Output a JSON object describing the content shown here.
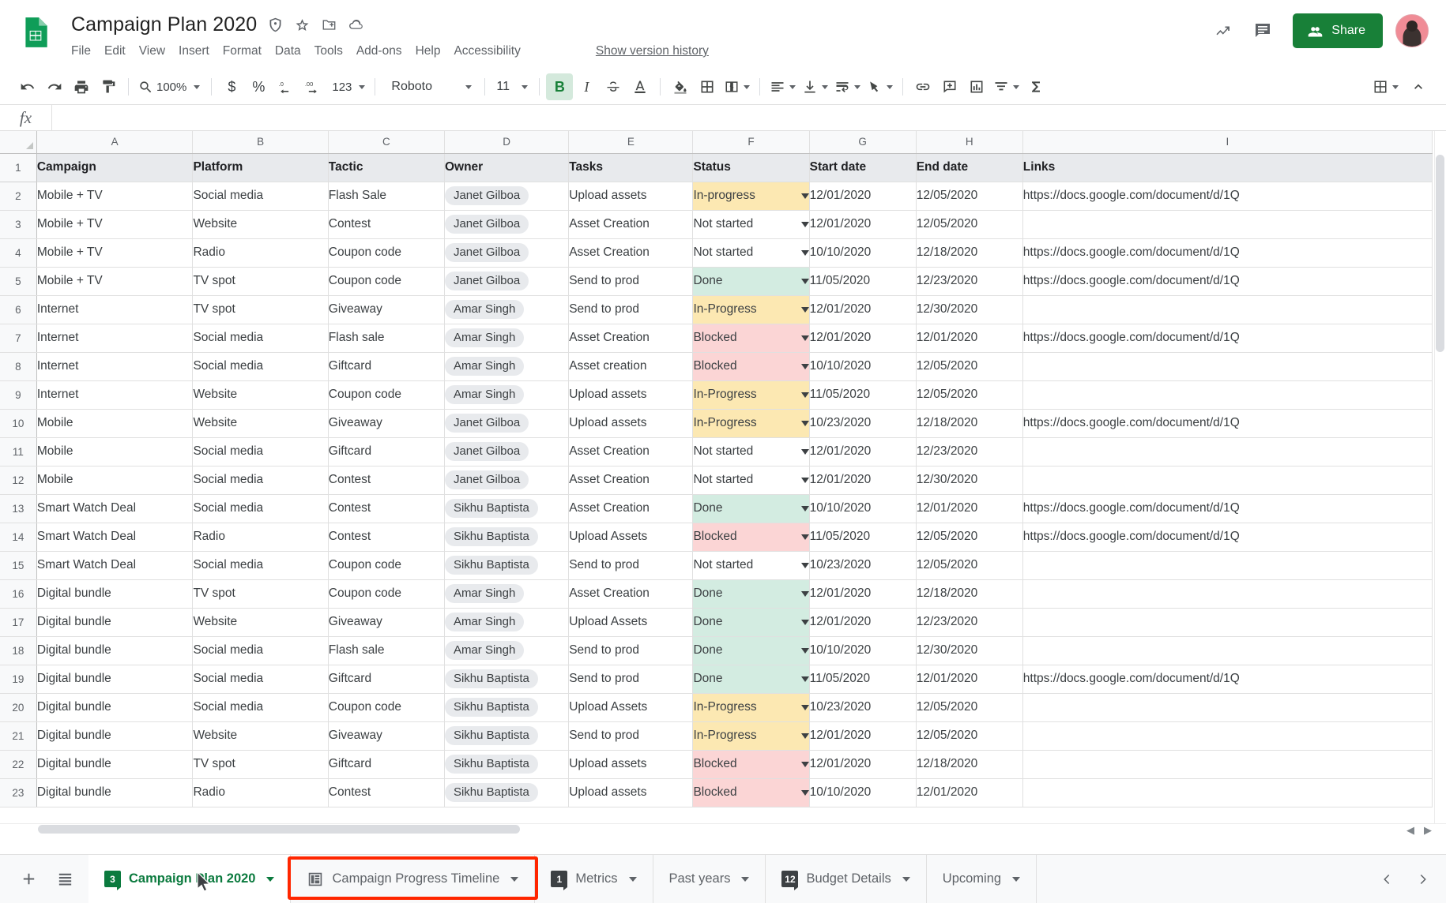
{
  "header": {
    "doc_title": "Campaign Plan 2020",
    "title_icons": [
      "shield-icon",
      "star-icon",
      "move-to-folder-icon",
      "cloud-saved-icon"
    ],
    "menus": [
      "File",
      "Edit",
      "View",
      "Insert",
      "Format",
      "Data",
      "Tools",
      "Add-ons",
      "Help",
      "Accessibility"
    ],
    "version_history_link": "Show version history",
    "trending_icon": "trending-up-icon",
    "comment_icon": "comment-icon",
    "share_label": "Share",
    "share_color": "#188038",
    "avatar_color": "#f08c96"
  },
  "toolbar": {
    "undo": "undo-icon",
    "redo": "redo-icon",
    "print": "print-icon",
    "paint_format": "paint-format-icon",
    "zoom_value": "100%",
    "currency": "$",
    "percent": "%",
    "decrease_decimal": ".0",
    "increase_decimal": ".00",
    "more_formats": "123",
    "font_name": "Roboto",
    "font_size": "11",
    "bold": "B",
    "italic": "I",
    "strikethrough": "S",
    "text_color": "A",
    "fill_color": "fill-color-icon",
    "borders": "borders-icon",
    "merge_cells": "merge-cells-icon",
    "horizontal_align": "align-left-icon",
    "vertical_align": "vertical-align-icon",
    "text_wrap": "text-wrap-icon",
    "text_rotation": "text-rotation-icon",
    "insert_link": "link-icon",
    "insert_comment": "insert-comment-icon",
    "insert_chart": "insert-chart-icon",
    "filter": "filter-icon",
    "functions": "sigma-icon",
    "view_mode": "view-mode-icon",
    "collapse": "collapse-toolbar-icon"
  },
  "formula_bar": {
    "fx_label": "fx",
    "value": "",
    "placeholder": ""
  },
  "grid": {
    "column_letters": [
      "A",
      "B",
      "C",
      "D",
      "E",
      "F",
      "G",
      "H",
      "I"
    ],
    "headers": [
      "Campaign",
      "Platform",
      "Tactic",
      "Owner",
      "Tasks",
      "Status",
      "Start date",
      "End date",
      "Links"
    ],
    "link_text": "https://docs.google.com/document/d/1Q",
    "status_colors": {
      "In-progress": "#fce8b2",
      "In-Progress": "#fce8b2",
      "Done": "#d3ece1",
      "Blocked": "#fbd5d5",
      "Not started": "#ffffff"
    },
    "rows": [
      {
        "n": "2",
        "campaign": "Mobile + TV",
        "platform": "Social media",
        "tactic": "Flash Sale",
        "owner": "Janet Gilboa",
        "task": "Upload assets",
        "status": "In-progress",
        "start": "12/01/2020",
        "end": "12/05/2020",
        "link": "https://docs.google.com/document/d/1Q"
      },
      {
        "n": "3",
        "campaign": "Mobile + TV",
        "platform": "Website",
        "tactic": "Contest",
        "owner": "Janet Gilboa",
        "task": "Asset Creation",
        "status": "Not started",
        "start": "12/01/2020",
        "end": "12/05/2020",
        "link": ""
      },
      {
        "n": "4",
        "campaign": "Mobile + TV",
        "platform": "Radio",
        "tactic": "Coupon code",
        "owner": "Janet Gilboa",
        "task": "Asset Creation",
        "status": "Not started",
        "start": "10/10/2020",
        "end": "12/18/2020",
        "link": "https://docs.google.com/document/d/1Q"
      },
      {
        "n": "5",
        "campaign": "Mobile + TV",
        "platform": "TV spot",
        "tactic": "Coupon code",
        "owner": "Janet Gilboa",
        "task": "Send to prod",
        "status": "Done",
        "start": "11/05/2020",
        "end": "12/23/2020",
        "link": "https://docs.google.com/document/d/1Q"
      },
      {
        "n": "6",
        "campaign": "Internet",
        "platform": "TV spot",
        "tactic": "Giveaway",
        "owner": "Amar Singh",
        "task": "Send to prod",
        "status": "In-Progress",
        "start": "12/01/2020",
        "end": "12/30/2020",
        "link": ""
      },
      {
        "n": "7",
        "campaign": "Internet",
        "platform": "Social media",
        "tactic": "Flash sale",
        "owner": "Amar Singh",
        "task": "Asset Creation",
        "status": "Blocked",
        "start": "12/01/2020",
        "end": "12/01/2020",
        "link": "https://docs.google.com/document/d/1Q"
      },
      {
        "n": "8",
        "campaign": "Internet",
        "platform": "Social media",
        "tactic": "Giftcard",
        "owner": "Amar Singh",
        "task": "Asset creation",
        "status": "Blocked",
        "start": "10/10/2020",
        "end": "12/05/2020",
        "link": ""
      },
      {
        "n": "9",
        "campaign": "Internet",
        "platform": "Website",
        "tactic": "Coupon code",
        "owner": "Amar Singh",
        "task": "Upload assets",
        "status": "In-Progress",
        "start": "11/05/2020",
        "end": "12/05/2020",
        "link": ""
      },
      {
        "n": "10",
        "campaign": "Mobile",
        "platform": "Website",
        "tactic": "Giveaway",
        "owner": "Janet Gilboa",
        "task": "Upload assets",
        "status": "In-Progress",
        "start": "10/23/2020",
        "end": "12/18/2020",
        "link": "https://docs.google.com/document/d/1Q"
      },
      {
        "n": "11",
        "campaign": "Mobile",
        "platform": "Social media",
        "tactic": "Giftcard",
        "owner": "Janet Gilboa",
        "task": "Asset Creation",
        "status": "Not started",
        "start": "12/01/2020",
        "end": "12/23/2020",
        "link": ""
      },
      {
        "n": "12",
        "campaign": "Mobile",
        "platform": "Social media",
        "tactic": "Contest",
        "owner": "Janet Gilboa",
        "task": "Asset Creation",
        "status": "Not started",
        "start": "12/01/2020",
        "end": "12/30/2020",
        "link": ""
      },
      {
        "n": "13",
        "campaign": "Smart Watch Deal",
        "platform": "Social media",
        "tactic": "Contest",
        "owner": "Sikhu Baptista",
        "task": "Asset Creation",
        "status": "Done",
        "start": "10/10/2020",
        "end": "12/01/2020",
        "link": "https://docs.google.com/document/d/1Q"
      },
      {
        "n": "14",
        "campaign": "Smart Watch Deal",
        "platform": "Radio",
        "tactic": "Contest",
        "owner": "Sikhu Baptista",
        "task": "Upload Assets",
        "status": "Blocked",
        "start": "11/05/2020",
        "end": "12/05/2020",
        "link": "https://docs.google.com/document/d/1Q"
      },
      {
        "n": "15",
        "campaign": "Smart Watch Deal",
        "platform": "Social media",
        "tactic": "Coupon code",
        "owner": "Sikhu Baptista",
        "task": "Send to prod",
        "status": "Not started",
        "start": "10/23/2020",
        "end": "12/05/2020",
        "link": ""
      },
      {
        "n": "16",
        "campaign": "Digital bundle",
        "platform": "TV spot",
        "tactic": "Coupon code",
        "owner": "Amar Singh",
        "task": "Asset Creation",
        "status": "Done",
        "start": "12/01/2020",
        "end": "12/18/2020",
        "link": ""
      },
      {
        "n": "17",
        "campaign": "Digital bundle",
        "platform": "Website",
        "tactic": "Giveaway",
        "owner": "Amar Singh",
        "task": "Upload Assets",
        "status": "Done",
        "start": "12/01/2020",
        "end": "12/23/2020",
        "link": ""
      },
      {
        "n": "18",
        "campaign": "Digital bundle",
        "platform": "Social media",
        "tactic": "Flash sale",
        "owner": "Amar Singh",
        "task": "Send to prod",
        "status": "Done",
        "start": "10/10/2020",
        "end": "12/30/2020",
        "link": ""
      },
      {
        "n": "19",
        "campaign": "Digital bundle",
        "platform": "Social media",
        "tactic": "Giftcard",
        "owner": "Sikhu Baptista",
        "task": "Send to prod",
        "status": "Done",
        "start": "11/05/2020",
        "end": "12/01/2020",
        "link": "https://docs.google.com/document/d/1Q"
      },
      {
        "n": "20",
        "campaign": "Digital bundle",
        "platform": "Social media",
        "tactic": "Coupon code",
        "owner": "Sikhu Baptista",
        "task": "Upload Assets",
        "status": "In-Progress",
        "start": "10/23/2020",
        "end": "12/05/2020",
        "link": ""
      },
      {
        "n": "21",
        "campaign": "Digital bundle",
        "platform": "Website",
        "tactic": "Giveaway",
        "owner": "Sikhu Baptista",
        "task": "Send to prod",
        "status": "In-Progress",
        "start": "12/01/2020",
        "end": "12/05/2020",
        "link": ""
      },
      {
        "n": "22",
        "campaign": "Digital bundle",
        "platform": "TV spot",
        "tactic": "Giftcard",
        "owner": "Sikhu Baptista",
        "task": "Upload assets",
        "status": "Blocked",
        "start": "12/01/2020",
        "end": "12/18/2020",
        "link": ""
      },
      {
        "n": "23",
        "campaign": "Digital bundle",
        "platform": "Radio",
        "tactic": "Contest",
        "owner": "Sikhu Baptista",
        "task": "Upload assets",
        "status": "Blocked",
        "start": "10/10/2020",
        "end": "12/01/2020",
        "link": ""
      }
    ]
  },
  "tabs_bar": {
    "add_sheet_icon": "add-sheet-icon",
    "all_sheets_icon": "all-sheets-list-icon",
    "prev_icon": "chevron-left-icon",
    "next_icon": "chevron-right-icon",
    "highlight_color": "#ff2600",
    "tabs": [
      {
        "label": "Campaign Plan 2020",
        "badge": "3",
        "active": true,
        "icon": "",
        "highlighted": false
      },
      {
        "label": "Campaign Progress Timeline",
        "badge": "",
        "active": false,
        "icon": "timeline-sheet-icon",
        "highlighted": true
      },
      {
        "label": "Metrics",
        "badge": "1",
        "active": false,
        "icon": "",
        "highlighted": false
      },
      {
        "label": "Past years",
        "badge": "",
        "active": false,
        "icon": "",
        "highlighted": false
      },
      {
        "label": "Budget Details",
        "badge": "12",
        "active": false,
        "icon": "",
        "highlighted": false
      },
      {
        "label": "Upcoming",
        "badge": "",
        "active": false,
        "icon": "",
        "highlighted": false
      }
    ]
  }
}
